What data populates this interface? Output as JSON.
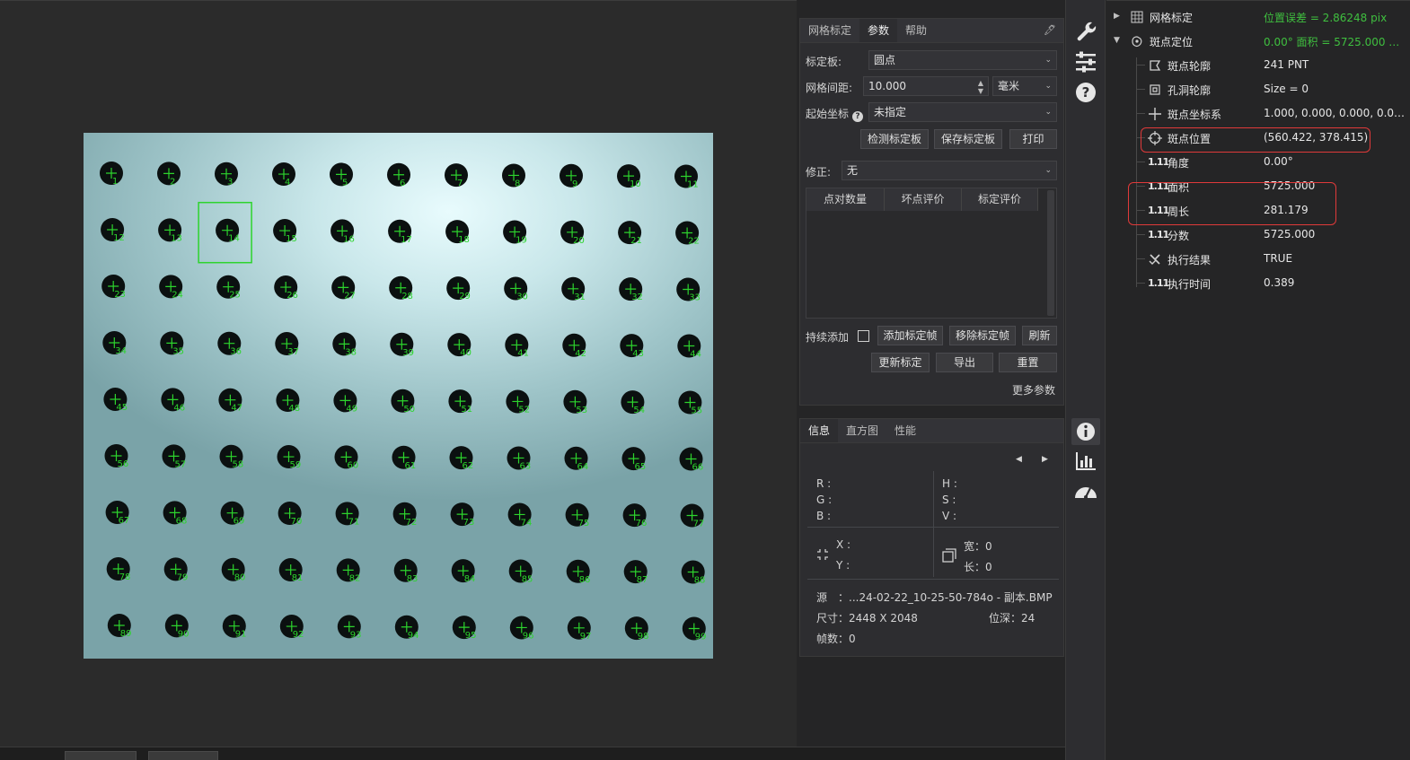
{
  "params_panel": {
    "tabs": [
      "网格标定",
      "参数",
      "帮助"
    ],
    "active_tab": 1,
    "board_label": "标定板:",
    "board_value": "圆点",
    "spacing_label": "网格间距:",
    "spacing_value": "10.000",
    "unit_value": "毫米",
    "origin_label": "起始坐标",
    "origin_value": "未指定",
    "buttons_row1": [
      "检测标定板",
      "保存标定板",
      "打印"
    ],
    "correction_label": "修正:",
    "correction_value": "无",
    "table_headers": [
      "点对数量",
      "坏点评价",
      "标定评价"
    ],
    "continuous_add_label": "持续添加",
    "buttons_row2": [
      "添加标定帧",
      "移除标定帧",
      "刷新"
    ],
    "buttons_row3": [
      "更新标定",
      "导出",
      "重置"
    ],
    "more_params": "更多参数"
  },
  "info_panel": {
    "tabs": [
      "信息",
      "直方图",
      "性能"
    ],
    "active_tab": 0,
    "rgb": [
      "R :",
      "G :",
      "B :"
    ],
    "hsv": [
      "H :",
      "S :",
      "V :"
    ],
    "xy": [
      "X :",
      "Y :"
    ],
    "wh": [
      "宽：0",
      "长：0"
    ],
    "source": "源　：...24-02-22_10-25-50-784o - 副本.BMP",
    "size": "尺寸：2448 X 2048",
    "bitdepth": "位深：24",
    "frames": "帧数：0"
  },
  "tree": {
    "nodes": [
      {
        "name": "网格标定",
        "value": "位置误差 = 2.86248 pix",
        "level": 0,
        "icon": "grid-calibration-icon",
        "green": true,
        "expander": "collapsed"
      },
      {
        "name": "斑点定位",
        "value": "0.00° 面积 = 5725.000 分...",
        "level": 0,
        "icon": "blob-locate-icon",
        "green": true,
        "expander": "expanded"
      },
      {
        "name": "斑点轮廓",
        "value": "241 PNT",
        "level": 1,
        "icon": "blob-contour-icon"
      },
      {
        "name": "孔洞轮廓",
        "value": "Size = 0",
        "level": 1,
        "icon": "hole-contour-icon"
      },
      {
        "name": "斑点坐标系",
        "value": "1.000, 0.000, 0.000, 0.000, ...",
        "level": 1,
        "icon": "coordinate-system-icon"
      },
      {
        "name": "斑点位置",
        "value": "(560.422, 378.415)",
        "level": 1,
        "icon": "crosshair-icon"
      },
      {
        "name": "角度",
        "value": "0.00°",
        "level": 1,
        "icon": "number-icon"
      },
      {
        "name": "面积",
        "value": "5725.000",
        "level": 1,
        "icon": "number-icon"
      },
      {
        "name": "周长",
        "value": "281.179",
        "level": 1,
        "icon": "number-icon"
      },
      {
        "name": "分数",
        "value": "5725.000",
        "level": 1,
        "icon": "number-icon"
      },
      {
        "name": "执行结果",
        "value": "TRUE",
        "level": 1,
        "icon": "result-icon"
      },
      {
        "name": "执行时间",
        "value": "0.389",
        "level": 1,
        "icon": "number-icon"
      }
    ],
    "number_badge": "1.11"
  },
  "image": {
    "rows": 9,
    "cols": 11,
    "selected_index": 14,
    "labels": [
      "1",
      "2",
      "3",
      "4",
      "5",
      "6",
      "7",
      "8",
      "9",
      "10",
      "11",
      "12",
      "13",
      "14",
      "15",
      "16",
      "17",
      "18",
      "19",
      "20",
      "21",
      "22",
      "23",
      "24",
      "25",
      "26",
      "27",
      "28",
      "29",
      "30",
      "31",
      "32",
      "33",
      "34",
      "35",
      "36",
      "37",
      "38",
      "39",
      "40",
      "41",
      "42",
      "43",
      "44",
      "45",
      "46",
      "47",
      "48",
      "49",
      "50",
      "51",
      "52",
      "53",
      "54",
      "55",
      "56",
      "57",
      "58",
      "59",
      "60",
      "61",
      "62",
      "63",
      "64",
      "65",
      "66",
      "67",
      "68",
      "69",
      "70",
      "71",
      "72",
      "73",
      "74",
      "75",
      "76",
      "77",
      "78",
      "79",
      "80",
      "81",
      "82",
      "83",
      "84",
      "85",
      "86",
      "87",
      "88",
      "89",
      "90",
      "91",
      "92",
      "93",
      "94",
      "95",
      "96",
      "97",
      "98",
      "99"
    ]
  },
  "colors": {
    "accent_green": "#2dd42d",
    "highlight_red": "#e03a3a",
    "value_green": "#3fbf3f"
  }
}
